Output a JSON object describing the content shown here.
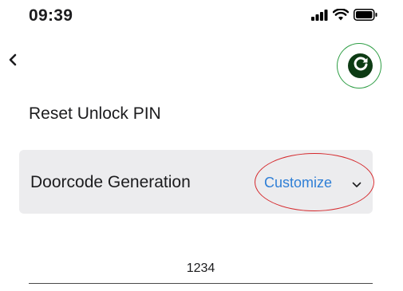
{
  "status_bar": {
    "time": "09:39",
    "icons": [
      "signal-icon",
      "wifi-icon",
      "battery-icon"
    ]
  },
  "nav": {
    "back_icon": "chevron-left-icon",
    "refresh_icon": "refresh-icon"
  },
  "page": {
    "title": "Reset Unlock PIN"
  },
  "doorcode": {
    "label": "Doorcode Generation",
    "selected_option": "Customize",
    "dropdown_icon": "chevron-down-icon"
  },
  "pin": {
    "value": "1234"
  },
  "colors": {
    "accent_link": "#2f7fd6",
    "panel_background": "#ececee",
    "refresh_background": "#0d3b14",
    "highlight_green": "#2e9e45",
    "highlight_red": "#d5282c"
  }
}
